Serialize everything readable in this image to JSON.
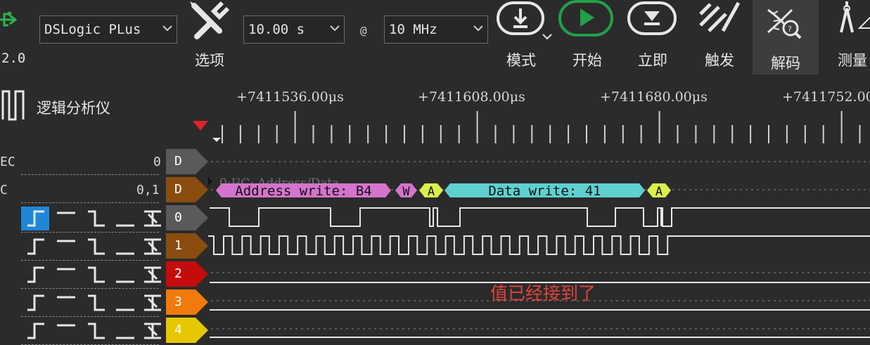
{
  "toolbar": {
    "version": "2.0",
    "device": "DSLogic PLus",
    "duration": "10.00 s",
    "at": "@",
    "rate": "10 MHz",
    "options_label": "选项",
    "mode_label": "模式",
    "start_label": "开始",
    "instant_label": "立即",
    "trigger_label": "触发",
    "decode_label": "解码",
    "measure_label": "测量",
    "start_color": "#20a04a"
  },
  "panel": {
    "title": "逻辑分析仪"
  },
  "ruler": {
    "times": [
      "+7411536.00μs",
      "+7411608.00μs",
      "+7411680.00μs",
      "+7411752.00"
    ]
  },
  "channels": {
    "decoder_rows": [
      {
        "name_fragment": "EC",
        "value": "0",
        "tag": "D",
        "tag_color": "#5a5a5a"
      },
      {
        "name_fragment": "C",
        "value": "0,1",
        "tag": "D",
        "tag_color": "#8a4d0f"
      }
    ],
    "logic_rows": [
      {
        "tag": "0",
        "tag_color": "#5a5a5a"
      },
      {
        "tag": "1",
        "tag_color": "#8a4d0f"
      },
      {
        "tag": "2",
        "tag_color": "#c40c0c"
      },
      {
        "tag": "3",
        "tag_color": "#f07a0c"
      },
      {
        "tag": "4",
        "tag_color": "#e6c800"
      }
    ]
  },
  "decode": {
    "hidden_header": "0:I²C: Address/Data",
    "address": "Address write: B4",
    "w": "W",
    "ack1": "A",
    "data": "Data write: 41",
    "ack2": "A",
    "address_color": "#d474cc",
    "ack_color": "#d9ef4c",
    "data_color": "#5fd0d0"
  },
  "annotation": {
    "text": "值已经接到了",
    "color": "#e0443a"
  }
}
